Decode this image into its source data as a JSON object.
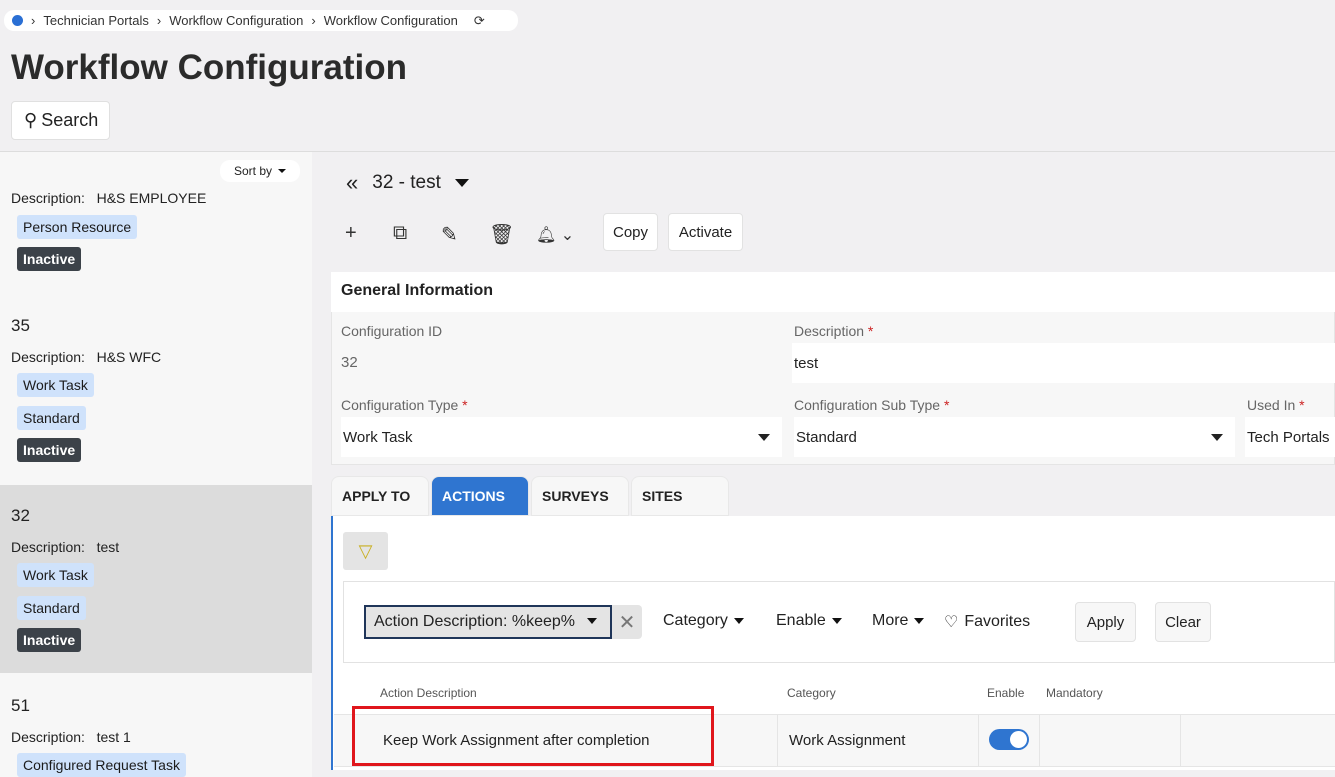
{
  "breadcrumb": [
    "Technician Portals",
    "Workflow Configuration",
    "Workflow Configuration"
  ],
  "title": "Workflow Configuration",
  "search_label": "Search",
  "sort_label": "Sort by",
  "list": [
    {
      "num": "",
      "description_label": "Description:",
      "description": "H&S EMPLOYEE",
      "tags": [
        "Person Resource"
      ],
      "status": "Inactive"
    },
    {
      "num": "35",
      "description_label": "Description:",
      "description": "H&S WFC",
      "tags": [
        "Work Task",
        "Standard"
      ],
      "status": "Inactive"
    },
    {
      "num": "32",
      "description_label": "Description:",
      "description": "test",
      "tags": [
        "Work Task",
        "Standard"
      ],
      "status": "Inactive"
    },
    {
      "num": "51",
      "description_label": "Description:",
      "description": "test 1",
      "tags": [
        "Configured Request Task"
      ],
      "status": ""
    }
  ],
  "record": {
    "title": "32 - test"
  },
  "toolbar": {
    "copy": "Copy",
    "activate": "Activate"
  },
  "general": {
    "header": "General Information",
    "config_id_label": "Configuration ID",
    "config_id": "32",
    "description_label": "Description",
    "description": "test",
    "config_type_label": "Configuration Type",
    "config_type": "Work Task",
    "config_sub_type_label": "Configuration Sub Type",
    "config_sub_type": "Standard",
    "used_in_label": "Used In",
    "used_in": "Tech Portals",
    "required": "*"
  },
  "tabs": [
    "APPLY TO",
    "ACTIONS",
    "SURVEYS",
    "SITES"
  ],
  "filters": {
    "chip": "Action Description: %keep%",
    "category": "Category",
    "enable": "Enable",
    "more": "More",
    "favorites": "Favorites",
    "apply": "Apply",
    "clear": "Clear"
  },
  "table": {
    "headers": [
      "Action Description",
      "Category",
      "Enable",
      "Mandatory"
    ],
    "rows": [
      {
        "action": "Keep Work Assignment after completion",
        "category": "Work Assignment",
        "enable": true
      }
    ]
  }
}
